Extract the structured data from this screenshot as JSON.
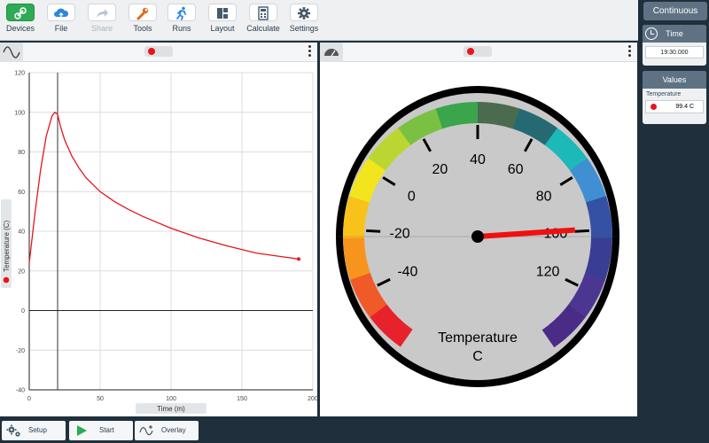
{
  "toolbar": {
    "items": [
      {
        "label": "Devices",
        "icon": "link-icon"
      },
      {
        "label": "File",
        "icon": "cloud-upload-icon"
      },
      {
        "label": "Share",
        "icon": "share-arrow-icon"
      },
      {
        "label": "Tools",
        "icon": "wrench-icon"
      },
      {
        "label": "Runs",
        "icon": "runner-icon"
      },
      {
        "label": "Layout",
        "icon": "layout-icon"
      },
      {
        "label": "Calculate",
        "icon": "calculator-icon"
      },
      {
        "label": "Settings",
        "icon": "gear-icon"
      }
    ]
  },
  "graph": {
    "xlabel": "Time (m)",
    "ylabel": "Temperature (C)"
  },
  "gauge": {
    "title": "Temperature",
    "unit": "C",
    "value": 99.4,
    "min": -60,
    "max": 140,
    "tick_labels": [
      "-40",
      "-20",
      "0",
      "20",
      "40",
      "60",
      "80",
      "100",
      "120"
    ]
  },
  "side": {
    "mode_button": "Continuous",
    "time_title": "Time",
    "time_value": "19:30.000",
    "values_title": "Values",
    "sensor_label": "Temperature",
    "sensor_value": "99.4 C"
  },
  "bottom": {
    "setup_label": "Setup",
    "start_label": "Start",
    "overlay_label": "Overlay"
  },
  "colors": {
    "accent": "#2dab55",
    "series": "#e8141c",
    "header": "#5f7283"
  },
  "chart_data": {
    "type": "line",
    "xlabel": "Time (m)",
    "ylabel": "Temperature (C)",
    "xlim": [
      0,
      200
    ],
    "ylim": [
      -40,
      120
    ],
    "x_ticks": [
      0,
      50,
      100,
      150,
      200
    ],
    "y_ticks": [
      -40,
      -20,
      0,
      20,
      40,
      60,
      80,
      100,
      120
    ],
    "cursor_x": 20,
    "series": [
      {
        "color": "#e8141c",
        "x": [
          0,
          4,
          8,
          12,
          16,
          18,
          20,
          22,
          25,
          30,
          35,
          40,
          50,
          60,
          70,
          80,
          100,
          120,
          140,
          160,
          180,
          190
        ],
        "y": [
          24,
          49,
          71,
          88,
          98,
          100,
          99,
          93,
          86,
          78,
          72,
          67,
          60,
          55,
          51,
          47.5,
          41.5,
          36.5,
          32.5,
          29,
          27,
          26
        ]
      }
    ]
  }
}
